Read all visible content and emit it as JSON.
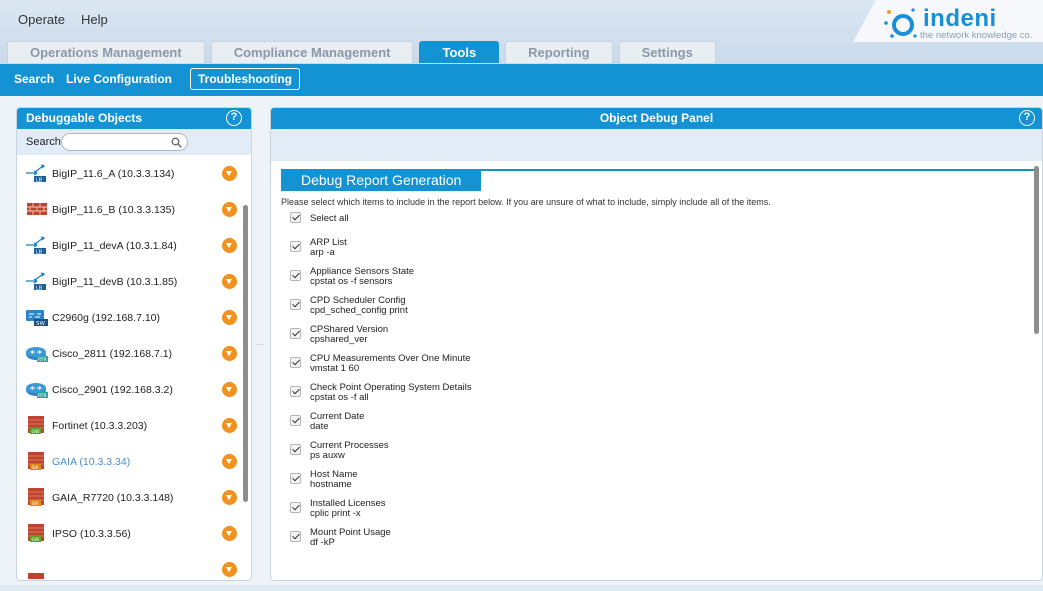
{
  "menu": {
    "operate": "Operate",
    "help": "Help"
  },
  "logo": {
    "word": "indeni",
    "tagline": "the network knowledge co."
  },
  "tabs": [
    {
      "label": "Operations Management",
      "active": false
    },
    {
      "label": "Compliance Management",
      "active": false
    },
    {
      "label": "Tools",
      "active": true
    },
    {
      "label": "Reporting",
      "active": false
    },
    {
      "label": "Settings",
      "active": false
    }
  ],
  "subnav": {
    "search": "Search",
    "live_config": "Live Configuration",
    "troubleshooting": "Troubleshooting"
  },
  "left_panel": {
    "title": "Debuggable Objects",
    "help": "?",
    "search_label": "Search",
    "search_value": "",
    "objects": [
      {
        "label": "BigIP_11.6_A (10.3.3.134)",
        "icon": "load-balancer-icon",
        "badge": "LB"
      },
      {
        "label": "BigIP_11.6_B (10.3.3.135)",
        "icon": "brick-wall-icon",
        "badge": ""
      },
      {
        "label": "BigIP_11_devA (10.3.1.84)",
        "icon": "load-balancer-icon",
        "badge": "LB"
      },
      {
        "label": "BigIP_11_devB (10.3.1.85)",
        "icon": "load-balancer-icon",
        "badge": "LB"
      },
      {
        "label": "C2960g (192.168.7.10)",
        "icon": "switch-icon",
        "badge": "SW"
      },
      {
        "label": "Cisco_2811 (192.168.7.1)",
        "icon": "router-icon",
        "badge": "RTR"
      },
      {
        "label": "Cisco_2901 (192.168.3.2)",
        "icon": "router-icon",
        "badge": "RTR"
      },
      {
        "label": "Fortinet (10.3.3.203)",
        "icon": "firewall-icon",
        "badge": "GW"
      },
      {
        "label": "GAIA (10.3.3.34)",
        "icon": "firewall-icon",
        "badge": "SA"
      },
      {
        "label": "GAIA_R7720 (10.3.3.148)",
        "icon": "firewall-icon",
        "badge": "SA"
      },
      {
        "label": "IPSO (10.3.3.56)",
        "icon": "firewall-icon",
        "badge": "GW"
      }
    ]
  },
  "right_panel": {
    "title": "Object Debug Panel",
    "help": "?",
    "report_title": "Debug Report Generation",
    "description": "Please select which items to include in the report below. If you are unsure of what to include, simply include all of the items.",
    "select_all": "Select all",
    "options": [
      {
        "name": "ARP List",
        "command": "arp -a"
      },
      {
        "name": "Appliance Sensors State",
        "command": "cpstat os -f sensors"
      },
      {
        "name": "CPD Scheduler Config",
        "command": "cpd_sched_config print"
      },
      {
        "name": "CPShared Version",
        "command": "cpshared_ver"
      },
      {
        "name": "CPU Measurements Over One Minute",
        "command": "vmstat 1 60"
      },
      {
        "name": "Check Point Operating System Details",
        "command": "cpstat os -f all"
      },
      {
        "name": "Current Date",
        "command": "date"
      },
      {
        "name": "Current Processes",
        "command": "ps auxw"
      },
      {
        "name": "Host Name",
        "command": "hostname"
      },
      {
        "name": "Installed Licenses",
        "command": "cplic print -x"
      },
      {
        "name": "Mount Point Usage",
        "command": "df -kP"
      }
    ]
  },
  "colors": {
    "accent": "#1493d4",
    "action": "#f0921d",
    "brick": "#c0432e"
  }
}
